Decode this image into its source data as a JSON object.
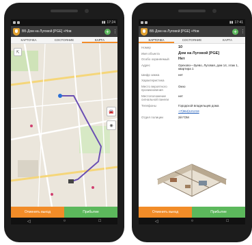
{
  "left": {
    "app_title": "ВБ Дом на Луговой [PGE] +Нов",
    "status_time": "17:24",
    "tabs": [
      "Карточка",
      "Состояние",
      "Карта"
    ],
    "active_tab": 2,
    "cancel": "Отменить выезд",
    "arrive": "Прибытие"
  },
  "right": {
    "app_title": "ВБ Дом на Луговой [PGE] +Нов",
    "status_time": "17:41",
    "tabs": [
      "Карточка",
      "Состояние",
      "Карта"
    ],
    "active_tab": 0,
    "cancel": "Отменить выезд",
    "arrive": "Прибытие",
    "fields": [
      {
        "k": "Номер",
        "v": "10",
        "style": "big"
      },
      {
        "k": "Имя объекта",
        "v": "Дом на Луговой [PGE]",
        "style": "big"
      },
      {
        "k": "Особо охраняемый",
        "v": "Нет",
        "style": "big"
      },
      {
        "k": "Адрес",
        "v": "Орехово—Зуево, Луговая, дом 14, этаж 1, квартира 1",
        "style": ""
      },
      {
        "k": "Шифр замка",
        "v": "нет",
        "style": ""
      },
      {
        "k": "Характеристика",
        "v": "",
        "style": ""
      },
      {
        "k": "Место вероятного проникновения",
        "v": "Окно",
        "style": ""
      },
      {
        "k": "Местоположение сигнальной панели",
        "v": "нет",
        "style": ""
      },
      {
        "k": "Телефоны",
        "v": "Городской владельцев дома",
        "style": ""
      },
      {
        "k": "",
        "v": "+7(964)121218",
        "style": "link"
      },
      {
        "k": "Отдел полиции",
        "v": "2й ГОМ",
        "style": ""
      }
    ]
  },
  "colors": {
    "accent": "#f28c28",
    "green": "#5cb85c",
    "route": "#6a4fb3"
  }
}
